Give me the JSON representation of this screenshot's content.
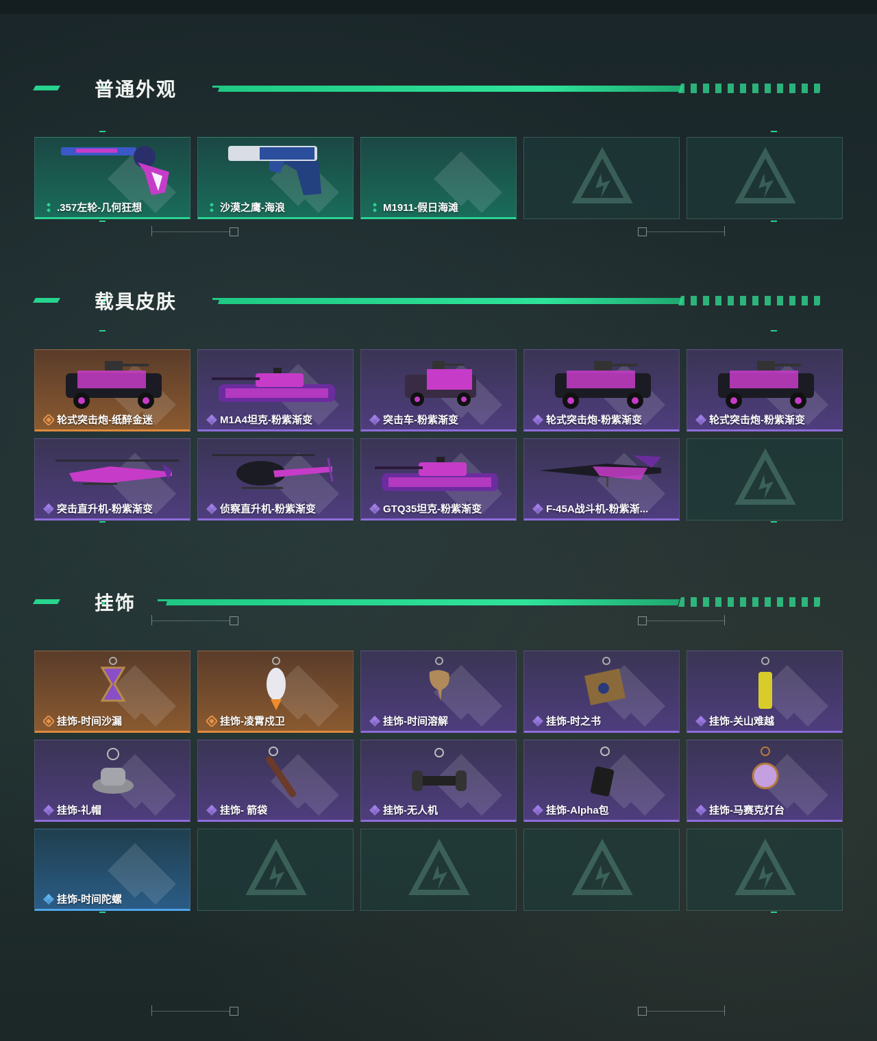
{
  "colors": {
    "accent_green": "#27d58e",
    "rarity_green": "#2ad493",
    "rarity_purple": "#8e6cdb",
    "rarity_orange": "#e08a3c",
    "rarity_blue": "#4fa6ec"
  },
  "sections": [
    {
      "title": "普通外观",
      "items": [
        {
          "label": ".357左轮-几何狂想",
          "rarity": "green",
          "icon": "revolver-icon"
        },
        {
          "label": "沙漠之鹰-海浪",
          "rarity": "green",
          "icon": "pistol-icon"
        },
        {
          "label": "M1911-假日海滩",
          "rarity": "green",
          "icon": ""
        },
        {
          "label": "",
          "rarity": "empty",
          "icon": "empty-slot-icon"
        },
        {
          "label": "",
          "rarity": "empty",
          "icon": "empty-slot-icon"
        }
      ]
    },
    {
      "title": "载具皮肤",
      "items": [
        {
          "label": "轮式突击炮-纸醉金迷",
          "rarity": "orange",
          "icon": "armored-car-icon"
        },
        {
          "label": "M1A4坦克-粉紫渐变",
          "rarity": "purple",
          "icon": "tank-icon"
        },
        {
          "label": "突击车-粉紫渐变",
          "rarity": "purple",
          "icon": "assault-car-icon"
        },
        {
          "label": "轮式突击炮-粉紫渐变",
          "rarity": "purple",
          "icon": "armored-car-icon"
        },
        {
          "label": "轮式突击炮-粉紫渐变",
          "rarity": "purple",
          "icon": "armored-car-icon"
        },
        {
          "label": "突击直升机-粉紫渐变",
          "rarity": "purple",
          "icon": "attack-helicopter-icon"
        },
        {
          "label": "侦察直升机-粉紫渐变",
          "rarity": "purple",
          "icon": "scout-helicopter-icon"
        },
        {
          "label": "GTQ35坦克-粉紫渐变",
          "rarity": "purple",
          "icon": "tank-icon"
        },
        {
          "label": "F-45A战斗机-粉紫渐...",
          "rarity": "purple",
          "icon": "fighter-jet-icon"
        },
        {
          "label": "",
          "rarity": "empty",
          "icon": "empty-slot-icon"
        }
      ]
    },
    {
      "title": "挂饰",
      "items": [
        {
          "label": "挂饰-时间沙漏",
          "rarity": "orange",
          "icon": "hourglass-charm-icon"
        },
        {
          "label": "挂饰-凌霄戍卫",
          "rarity": "orange",
          "icon": "rocket-charm-icon"
        },
        {
          "label": "挂饰-时间溶解",
          "rarity": "purple",
          "icon": "melting-clock-charm-icon"
        },
        {
          "label": "挂饰-时之书",
          "rarity": "purple",
          "icon": "book-charm-icon"
        },
        {
          "label": "挂饰-关山难越",
          "rarity": "purple",
          "icon": "scroll-charm-icon"
        },
        {
          "label": "挂饰-礼帽",
          "rarity": "purple",
          "icon": "hat-charm-icon"
        },
        {
          "label": "挂饰- 箭袋",
          "rarity": "purple",
          "icon": "quiver-charm-icon"
        },
        {
          "label": "挂饰-无人机",
          "rarity": "purple",
          "icon": "drone-charm-icon"
        },
        {
          "label": "挂饰-Alpha包",
          "rarity": "purple",
          "icon": "bag-charm-icon"
        },
        {
          "label": "挂饰-马赛克灯台",
          "rarity": "purple",
          "icon": "lantern-charm-icon"
        },
        {
          "label": "挂饰-时间陀螺",
          "rarity": "blue",
          "icon": ""
        },
        {
          "label": "",
          "rarity": "empty",
          "icon": "empty-slot-icon"
        },
        {
          "label": "",
          "rarity": "empty",
          "icon": "empty-slot-icon"
        },
        {
          "label": "",
          "rarity": "empty",
          "icon": "empty-slot-icon"
        },
        {
          "label": "",
          "rarity": "empty",
          "icon": "empty-slot-icon"
        }
      ]
    }
  ]
}
